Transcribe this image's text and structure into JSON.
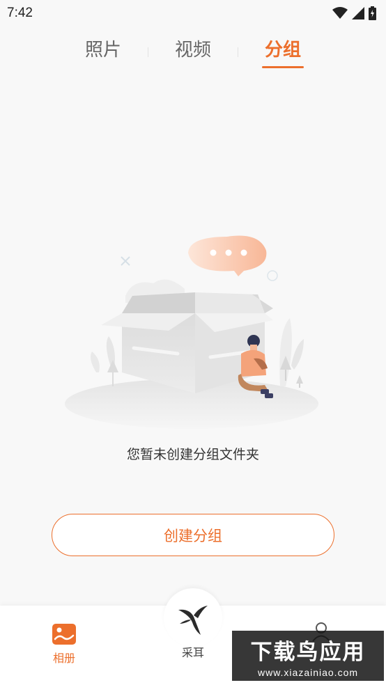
{
  "status": {
    "time": "7:42"
  },
  "tabs": [
    {
      "label": "照片",
      "active": false
    },
    {
      "label": "视频",
      "active": false
    },
    {
      "label": "分组",
      "active": true
    }
  ],
  "empty_state": {
    "message": "您暂未创建分组文件夹",
    "create_button": "创建分组"
  },
  "bottom_nav": [
    {
      "label": "相册",
      "icon": "album-icon",
      "active": true
    },
    {
      "label": "采耳",
      "icon": "bird-logo-icon",
      "active": false
    },
    {
      "label": "",
      "icon": "profile-icon",
      "active": false
    }
  ],
  "watermark": {
    "main": "下载鸟应用",
    "sub": "www.xiazainiao.com"
  },
  "colors": {
    "accent": "#ec6f2c",
    "background": "#f8f8f8"
  }
}
